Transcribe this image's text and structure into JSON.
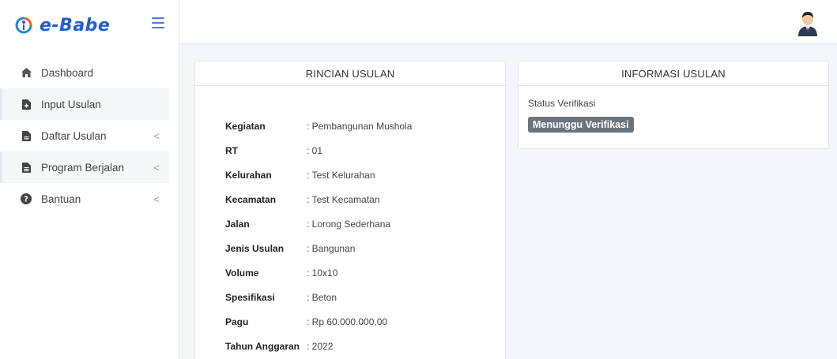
{
  "brand": {
    "name": "e-Babe"
  },
  "sidebar": {
    "items": [
      {
        "label": "Dashboard",
        "icon": "home-icon"
      },
      {
        "label": "Input Usulan",
        "icon": "file-plus-icon"
      },
      {
        "label": "Daftar Usulan",
        "icon": "file-icon",
        "chevron": "<"
      },
      {
        "label": "Program Berjalan",
        "icon": "file-list-icon",
        "chevron": "<"
      },
      {
        "label": "Bantuan",
        "icon": "question-circle-icon",
        "chevron": "<"
      }
    ]
  },
  "rincian": {
    "title": "RINCIAN USULAN",
    "rows": [
      {
        "key": "Kegiatan",
        "value": ": Pembangunan Mushola"
      },
      {
        "key": "RT",
        "value": ": 01"
      },
      {
        "key": "Kelurahan",
        "value": ": Test Kelurahan"
      },
      {
        "key": "Kecamatan",
        "value": ": Test Kecamatan"
      },
      {
        "key": "Jalan",
        "value": ": Lorong Sederhana"
      },
      {
        "key": "Jenis Usulan",
        "value": ": Bangunan"
      },
      {
        "key": "Volume",
        "value": ": 10x10"
      },
      {
        "key": "Spesifikasi",
        "value": ": Beton"
      },
      {
        "key": "Pagu",
        "value": ": Rp 60.000.000,00"
      },
      {
        "key": "Tahun Anggaran",
        "value": ": 2022"
      }
    ]
  },
  "informasi": {
    "title": "INFORMASI USULAN",
    "status_label": "Status Verifikasi",
    "status_badge": "Menunggu Verifikasi"
  },
  "colors": {
    "brand": "#1f5fd1",
    "badge": "#6c757d",
    "logo_accent": "#f05a28"
  }
}
